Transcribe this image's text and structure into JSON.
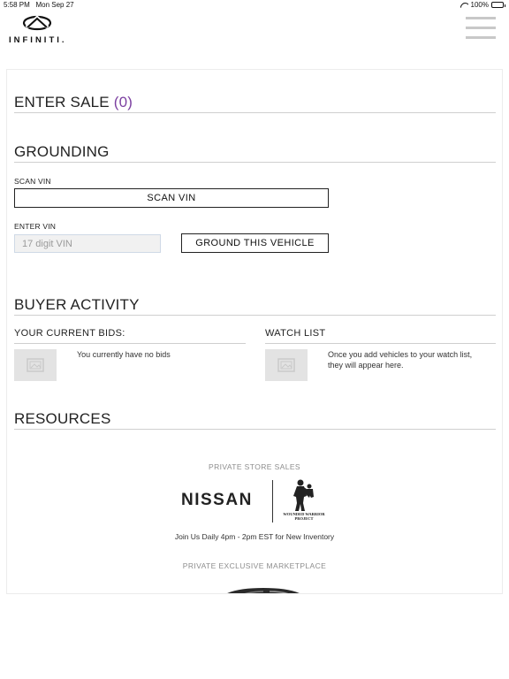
{
  "status_bar": {
    "time": "5:58 PM",
    "date": "Mon Sep 27",
    "battery": "100%"
  },
  "brand": {
    "name": "INFINITI."
  },
  "enter_sale": {
    "title": "ENTER SALE",
    "count": "(0)"
  },
  "grounding": {
    "title": "GROUNDING",
    "scan_label": "SCAN VIN",
    "scan_button": "SCAN VIN",
    "enter_label": "ENTER VIN",
    "vin_placeholder": "17 digit VIN",
    "ground_button": "GROUND THIS VEHICLE"
  },
  "buyer_activity": {
    "title": "BUYER ACTIVITY",
    "bids": {
      "title": "YOUR CURRENT BIDS:",
      "empty_text": "You currently have no bids"
    },
    "watch": {
      "title": "WATCH LIST",
      "empty_text": "Once you add vehicles to your watch list, they will appear here."
    }
  },
  "resources": {
    "title": "RESOURCES",
    "private_store": {
      "label": "PRIVATE STORE SALES",
      "brand": "NISSAN",
      "partner": "WOUNDED WARRIOR PROJECT",
      "caption": "Join Us Daily 4pm - 2pm EST for New Inventory"
    },
    "exclusive": {
      "label": "PRIVATE EXCLUSIVE MARKETPLACE"
    }
  },
  "colors": {
    "accent_count": "#7b3fa0",
    "rule": "#cfcfcf",
    "placeholder_bg": "#f1f1f1"
  },
  "icons": [
    "wifi-icon",
    "battery-icon",
    "infiniti-logo-icon",
    "hamburger-menu-icon",
    "image-placeholder-icon",
    "wounded-warrior-logo-icon"
  ]
}
